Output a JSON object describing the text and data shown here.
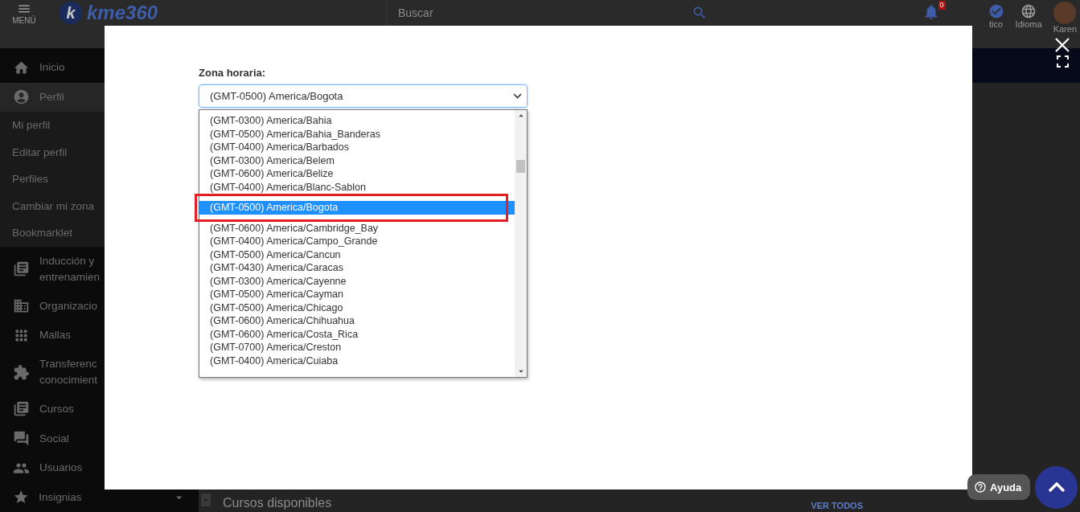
{
  "header": {
    "menu_label": "MENÚ",
    "logo_letter": "k",
    "logo_text": "kme360",
    "search_placeholder": "Buscar",
    "notification_count": "0",
    "items": [
      {
        "label": "tico"
      },
      {
        "label": "Idioma"
      },
      {
        "label": "Karen"
      }
    ]
  },
  "sidebar": {
    "items": [
      {
        "kind": "main",
        "lines": [
          "Inicio"
        ],
        "selected": false
      },
      {
        "kind": "main",
        "lines": [
          "Perfil"
        ],
        "selected": true
      },
      {
        "kind": "sub",
        "lines": [
          "Mi perfil"
        ],
        "selected": false
      },
      {
        "kind": "sub",
        "lines": [
          "Editar perfil"
        ],
        "selected": false
      },
      {
        "kind": "sub",
        "lines": [
          "Perfiles"
        ],
        "selected": false
      },
      {
        "kind": "sub",
        "lines": [
          "Cambiar mi zona"
        ],
        "selected": false
      },
      {
        "kind": "sub",
        "lines": [
          "Bookmarklet"
        ],
        "selected": false
      },
      {
        "kind": "main",
        "lines": [
          "Inducción y",
          "entrenamien"
        ],
        "selected": false
      },
      {
        "kind": "main",
        "lines": [
          "Organizacio"
        ],
        "selected": false
      },
      {
        "kind": "main",
        "lines": [
          "Mallas"
        ],
        "selected": false
      },
      {
        "kind": "main",
        "lines": [
          "Transferenc",
          "conocimient"
        ],
        "selected": false
      },
      {
        "kind": "main",
        "lines": [
          "Cursos"
        ],
        "selected": false
      },
      {
        "kind": "main",
        "lines": [
          "Social"
        ],
        "selected": false
      },
      {
        "kind": "main",
        "lines": [
          "Usuarios"
        ],
        "selected": false
      },
      {
        "kind": "main",
        "lines": [
          "Insignias"
        ],
        "selected": false,
        "expandable": true
      }
    ]
  },
  "content": {
    "section_title": "Cursos disponibles",
    "section_link": "VER TODOS"
  },
  "modal": {
    "field_label": "Zona horaria:",
    "select_value": "(GMT-0500) America/Bogota",
    "options": [
      {
        "label": "(GMT-0300) America/Bahia",
        "selected": false,
        "framed": false
      },
      {
        "label": "(GMT-0500) America/Bahia_Banderas",
        "selected": false,
        "framed": false
      },
      {
        "label": "(GMT-0400) America/Barbados",
        "selected": false,
        "framed": false
      },
      {
        "label": "(GMT-0300) America/Belem",
        "selected": false,
        "framed": false
      },
      {
        "label": "(GMT-0600) America/Belize",
        "selected": false,
        "framed": false
      },
      {
        "label": "(GMT-0400) America/Blanc-Sablon",
        "selected": false,
        "framed": false
      },
      {
        "label": "(GMT-0500) America/Bogota",
        "selected": true,
        "framed": true
      },
      {
        "label": "(GMT-0600) America/Cambridge_Bay",
        "selected": false,
        "framed": false
      },
      {
        "label": "(GMT-0400) America/Campo_Grande",
        "selected": false,
        "framed": false
      },
      {
        "label": "(GMT-0500) America/Cancun",
        "selected": false,
        "framed": false
      },
      {
        "label": "(GMT-0430) America/Caracas",
        "selected": false,
        "framed": false
      },
      {
        "label": "(GMT-0300) America/Cayenne",
        "selected": false,
        "framed": false
      },
      {
        "label": "(GMT-0500) America/Cayman",
        "selected": false,
        "framed": false
      },
      {
        "label": "(GMT-0500) America/Chicago",
        "selected": false,
        "framed": false
      },
      {
        "label": "(GMT-0600) America/Chihuahua",
        "selected": false,
        "framed": false
      },
      {
        "label": "(GMT-0600) America/Costa_Rica",
        "selected": false,
        "framed": false
      },
      {
        "label": "(GMT-0700) America/Creston",
        "selected": false,
        "framed": false
      },
      {
        "label": "(GMT-0400) America/Cuiaba",
        "selected": false,
        "framed": false
      }
    ]
  },
  "help_button": "Ayuda"
}
